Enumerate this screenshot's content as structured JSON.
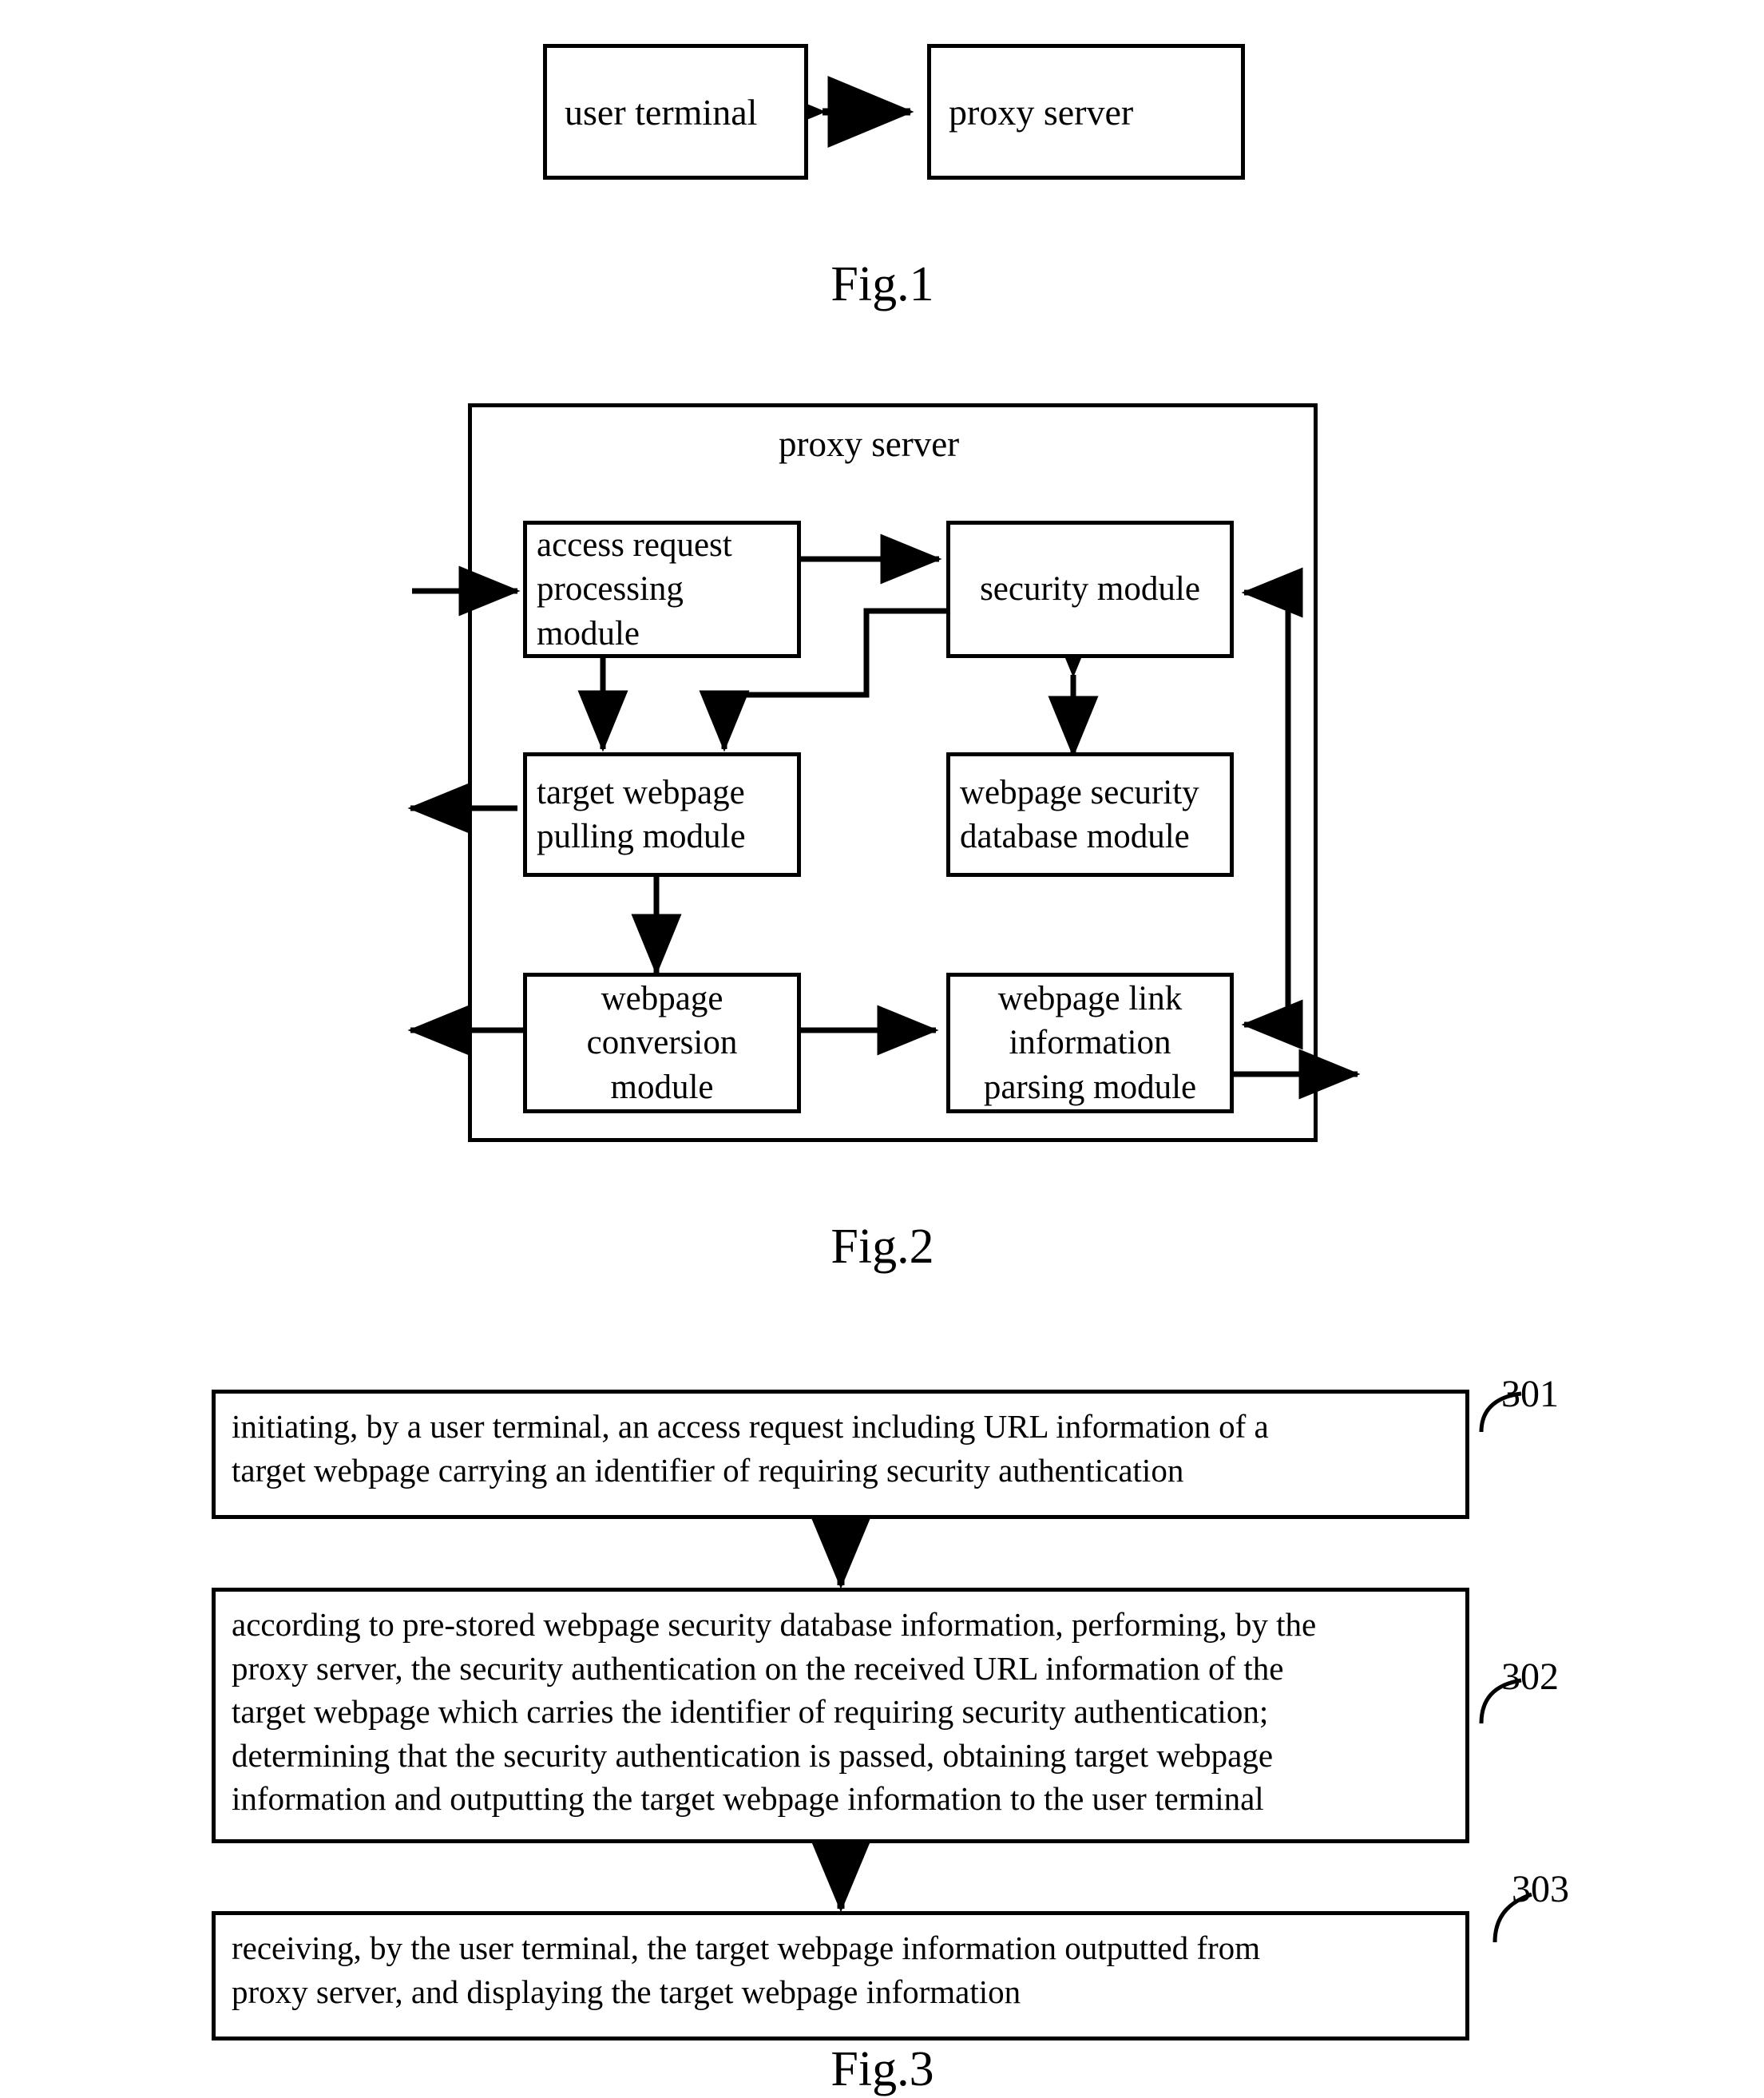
{
  "figures": [
    {
      "id": "fig1",
      "caption": "Fig.1",
      "nodes": [
        {
          "name": "user-terminal",
          "label": "user  terminal"
        },
        {
          "name": "proxy-server",
          "label": "proxy server"
        }
      ],
      "connector": "bidirectional-arrow"
    },
    {
      "id": "fig2",
      "caption": "Fig.2",
      "container_label": "proxy server",
      "nodes": [
        {
          "name": "access-request-processing-module",
          "lines": [
            "access   request",
            "processing",
            "module"
          ]
        },
        {
          "name": "security-module",
          "lines": [
            "security module"
          ]
        },
        {
          "name": "target-webpage-pulling-module",
          "lines": [
            "target    webpage",
            "pulling module"
          ]
        },
        {
          "name": "webpage-security-database-module",
          "lines": [
            "webpage   security",
            "database module"
          ]
        },
        {
          "name": "webpage-conversion-module",
          "lines": [
            "webpage",
            "conversion",
            "module"
          ]
        },
        {
          "name": "webpage-link-information-parsing-module",
          "lines": [
            "webpage link",
            "information",
            "parsing module"
          ]
        }
      ]
    },
    {
      "id": "fig3",
      "caption": "Fig.3",
      "steps": [
        {
          "ref": "301",
          "name": "step-301",
          "lines": [
            "initiating, by a user terminal, an access request including URL information of a",
            "target webpage carrying an identifier of requiring security authentication"
          ]
        },
        {
          "ref": "302",
          "name": "step-302",
          "lines": [
            "according to pre-stored webpage security database information, performing, by the",
            "proxy server, the security authentication on the received URL information of the",
            "target webpage which carries the identifier of requiring security authentication;",
            "determining that the security authentication is passed, obtaining target webpage",
            "information and outputting the target webpage information to the user terminal"
          ]
        },
        {
          "ref": "303",
          "name": "step-303",
          "lines": [
            "receiving, by the user terminal, the target webpage information outputted from",
            "proxy server, and displaying the target webpage information"
          ]
        }
      ]
    }
  ],
  "colors": {
    "stroke": "#000000",
    "fill": "#ffffff",
    "background": "#ffffff"
  }
}
